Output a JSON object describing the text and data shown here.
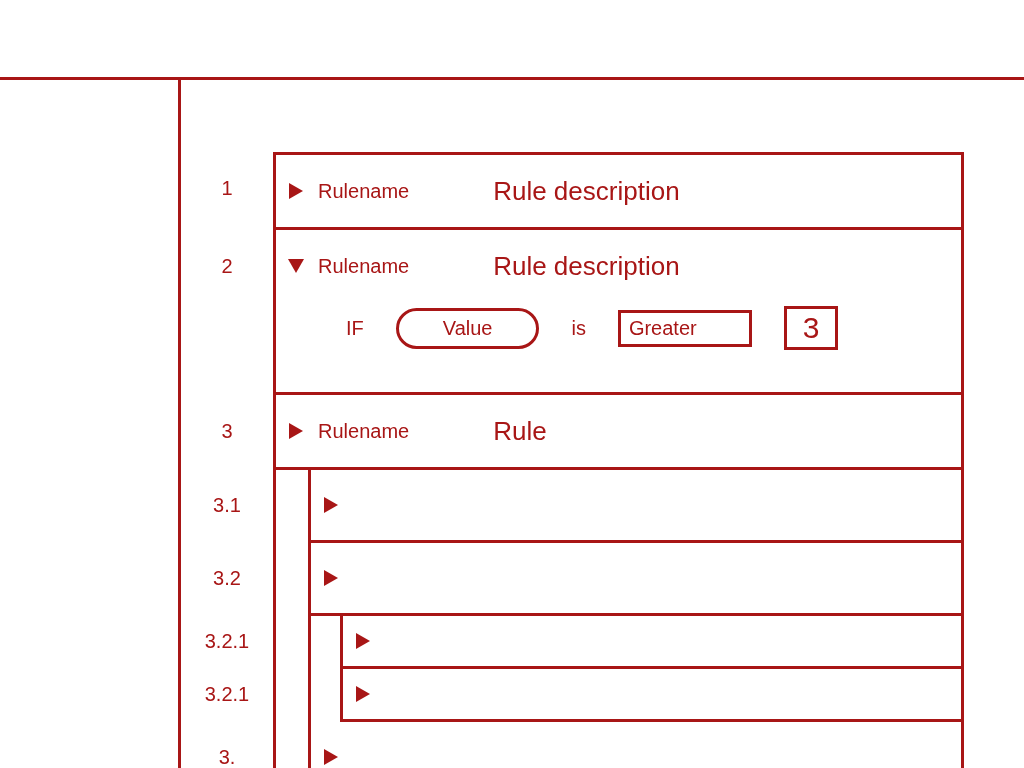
{
  "rules": [
    {
      "number": "1",
      "name": "Rulename",
      "description": "Rule description",
      "expanded": false
    },
    {
      "number": "2",
      "name": "Rulename",
      "description": "Rule description",
      "expanded": true,
      "condition": {
        "keyword": "IF",
        "field": "Value",
        "operator_label": "is",
        "comparison": "Greater",
        "value": "3"
      }
    },
    {
      "number": "3",
      "name": "Rulename",
      "description": "Rule",
      "expanded": false,
      "children": [
        {
          "number": "3.1",
          "expanded": false
        },
        {
          "number": "3.2",
          "expanded": false,
          "children": [
            {
              "number": "3.2.1",
              "expanded": false
            },
            {
              "number": "3.2.1",
              "expanded": false
            }
          ]
        },
        {
          "number": "3.",
          "expanded": false
        }
      ]
    }
  ]
}
